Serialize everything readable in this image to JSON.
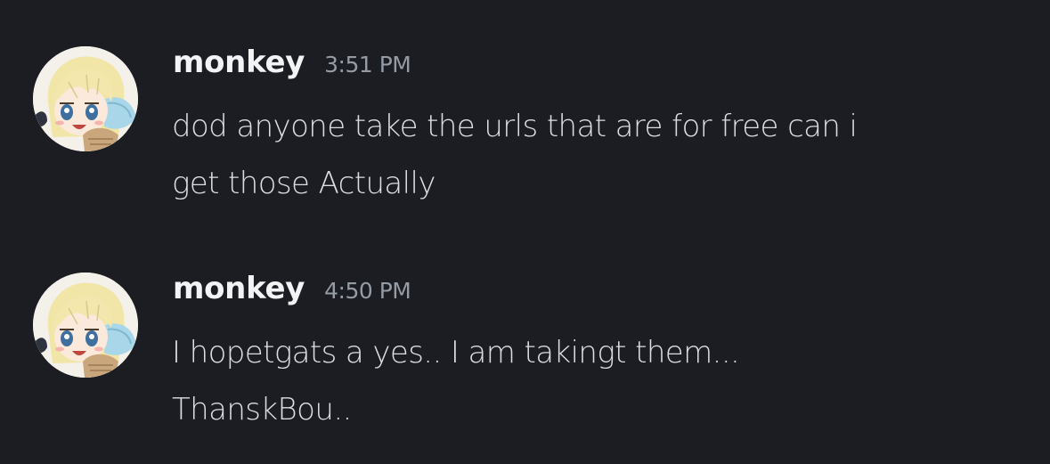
{
  "colors": {
    "background": "#1c1d23",
    "username": "#f2f3f5",
    "timestamp": "#949ba4",
    "message_text": "#dbdee1"
  },
  "messages": [
    {
      "author": "monkey",
      "timestamp": "3:51 PM",
      "avatar_icon": "anime-character-avatar",
      "lines": [
        "dod anyone take the urls that are for free can i",
        "get those Actually"
      ]
    },
    {
      "author": "monkey",
      "timestamp": "4:50 PM",
      "avatar_icon": "anime-character-avatar",
      "lines": [
        "I hopetgats a yes.. I am takingt them...",
        "ThanskBou.."
      ]
    }
  ]
}
